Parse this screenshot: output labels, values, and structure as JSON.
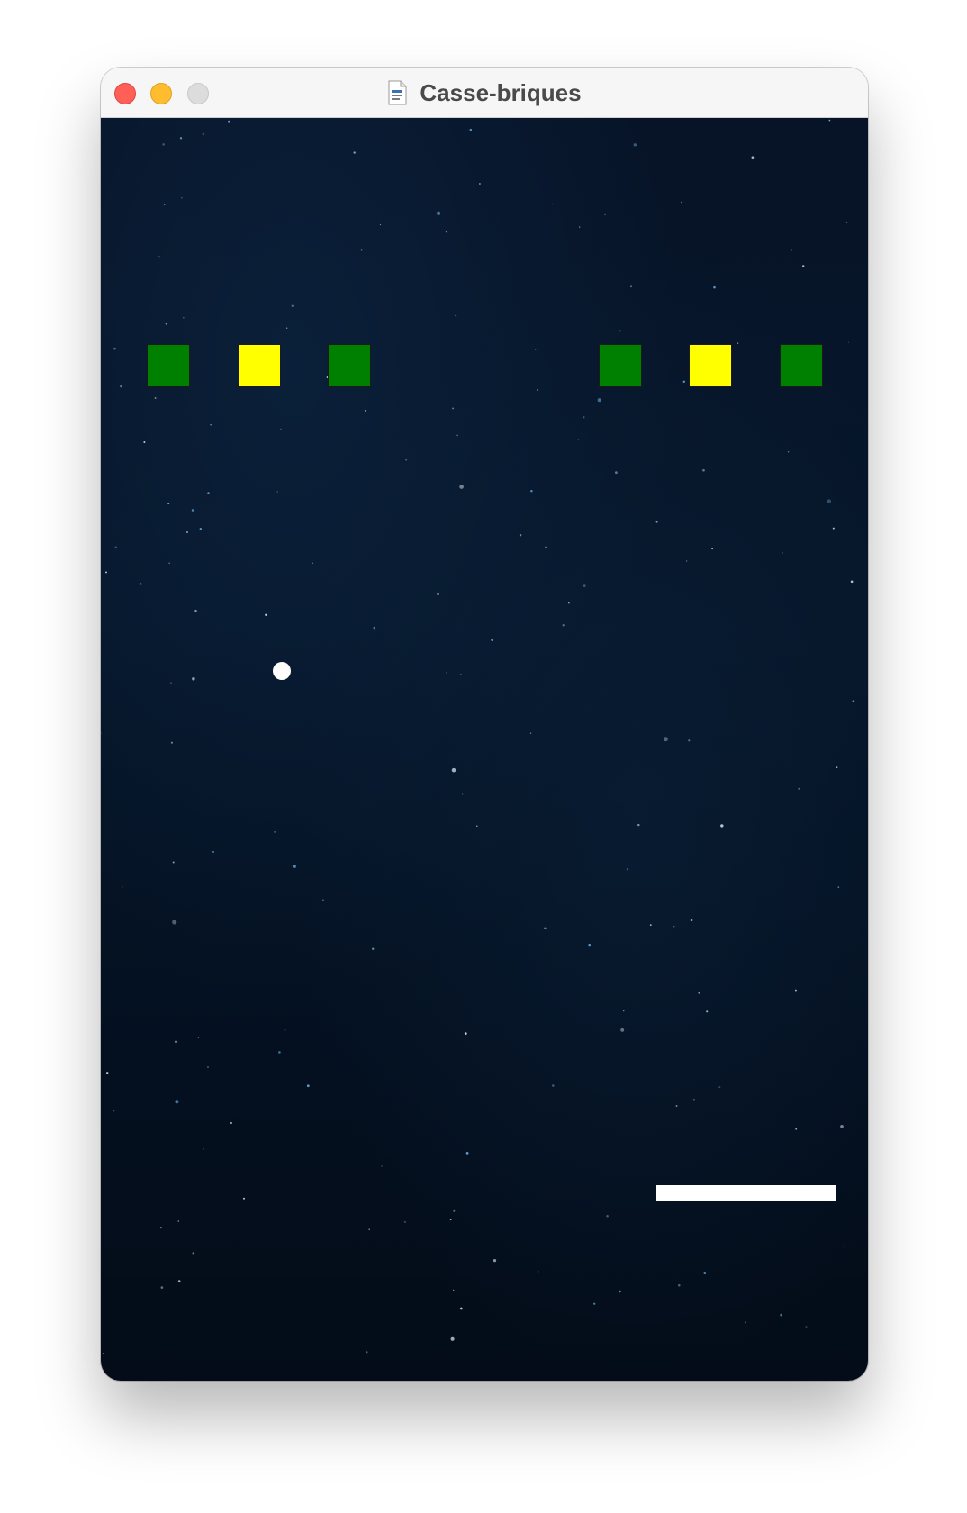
{
  "window": {
    "title": "Casse-briques",
    "icon": "document-icon"
  },
  "colors": {
    "green_brick": "#008000",
    "yellow_brick": "#ffff00",
    "ball": "#ffffff",
    "paddle": "#ffffff",
    "background": "#061428"
  },
  "bricks": [
    {
      "color": "green"
    },
    {
      "color": "yellow"
    },
    {
      "color": "green"
    },
    {
      "color": "green"
    },
    {
      "color": "yellow"
    },
    {
      "color": "green"
    }
  ]
}
